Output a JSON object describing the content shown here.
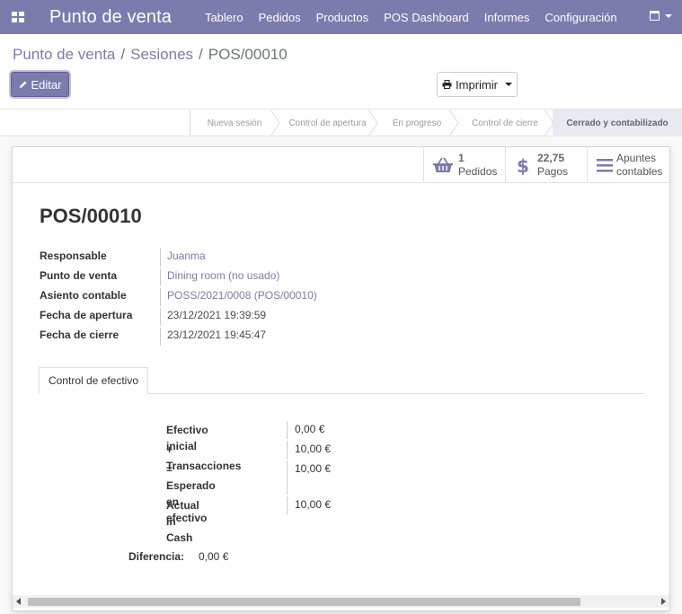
{
  "navbar": {
    "brand": "Punto de venta",
    "menu": [
      "Tablero",
      "Pedidos",
      "Productos",
      "POS Dashboard",
      "Informes",
      "Configuración"
    ],
    "icons": {
      "apps": "apps-grid-icon",
      "calendar": "calendar-icon"
    }
  },
  "breadcrumb": {
    "items": [
      "Punto de venta",
      "Sesiones"
    ],
    "current": "POS/00010"
  },
  "buttons": {
    "edit": "Editar",
    "print": "Imprimir"
  },
  "stages": [
    {
      "label": "Nueva sesión",
      "active": false
    },
    {
      "label": "Control de apertura",
      "active": false
    },
    {
      "label": "En progreso",
      "active": false
    },
    {
      "label": "Control de cierre",
      "active": false
    },
    {
      "label": "Cerrado y contabilizado",
      "active": true
    }
  ],
  "smart_buttons": {
    "orders": {
      "value": "1",
      "label": "Pedidos",
      "icon": "basket-icon"
    },
    "payments": {
      "value": "22,75",
      "label": "Pagos",
      "icon": "dollar-icon"
    },
    "entries": {
      "label_line1": "Apuntes",
      "label_line2": "contables",
      "icon": "list-icon"
    }
  },
  "record": {
    "name": "POS/00010",
    "fields": [
      {
        "label": "Responsable",
        "value": "Juanma",
        "link": true
      },
      {
        "label": "Punto de venta",
        "value": "Dining room (no usado)",
        "link": true
      },
      {
        "label": "Asiento contable",
        "value": "POSS/2021/0008 (POS/00010)",
        "link": true
      },
      {
        "label": "Fecha de apertura",
        "value": "23/12/2021 19:39:59",
        "link": false
      },
      {
        "label": "Fecha de cierre",
        "value": "23/12/2021 19:45:47",
        "link": false
      }
    ]
  },
  "tab": {
    "label": "Control de efectivo"
  },
  "cash": {
    "rows": [
      {
        "label": "Efectivo inicial",
        "value": "0,00 €"
      },
      {
        "label": "+ Transacciones",
        "value": "10,00 €"
      },
      {
        "label_line1": "= Esperado en",
        "label_line2": "efectivo",
        "value": "10,00 €"
      },
      {
        "label": "Actual in Cash",
        "value": "10,00 €"
      }
    ],
    "difference_label": "Diferencia:",
    "difference_value": "0,00 €"
  },
  "colors": {
    "brand": "#7c7bad",
    "active_stage": "#e8e9f1"
  }
}
